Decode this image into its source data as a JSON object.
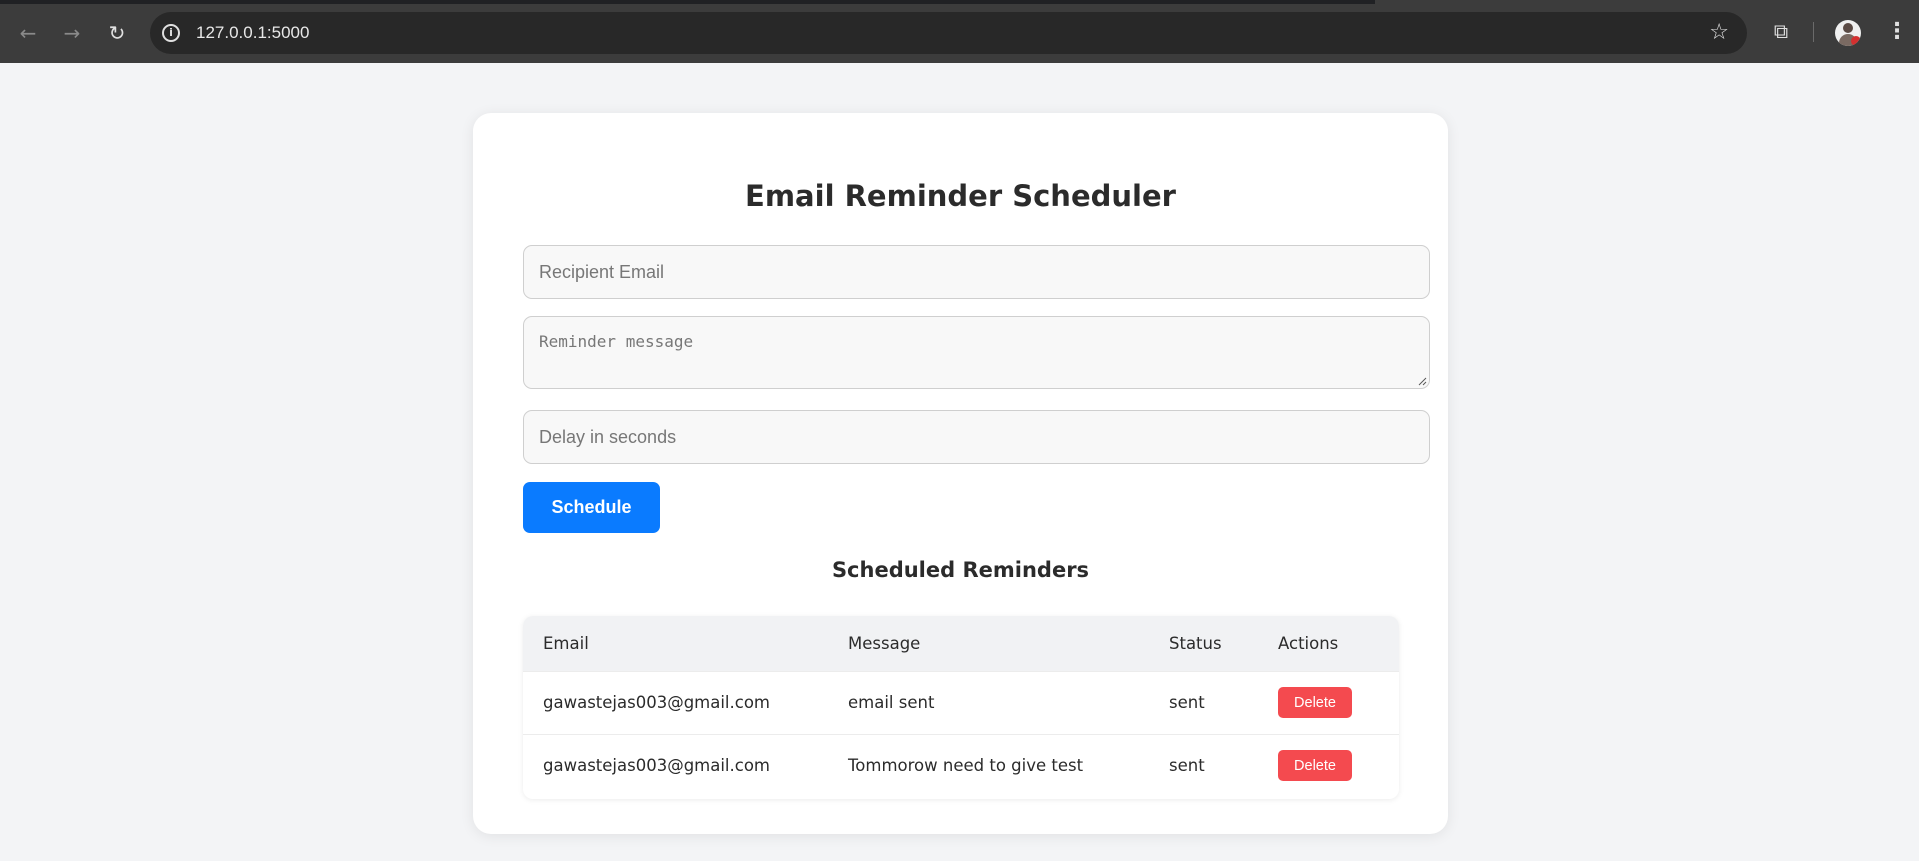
{
  "browser": {
    "url": "127.0.0.1:5000",
    "icons": {
      "back": "arrow-left-icon",
      "forward": "arrow-right-icon",
      "reload": "reload-icon",
      "info": "info-icon",
      "bookmark": "star-icon",
      "extensions": "puzzle-icon",
      "profile": "avatar",
      "menu": "kebab-menu-icon"
    }
  },
  "app": {
    "title": "Email Reminder Scheduler",
    "form": {
      "email_placeholder": "Recipient Email",
      "message_placeholder": "Reminder message",
      "delay_placeholder": "Delay in seconds",
      "submit_label": "Schedule"
    },
    "list_title": "Scheduled Reminders",
    "table": {
      "columns": [
        "Email",
        "Message",
        "Status",
        "Actions"
      ],
      "rows": [
        {
          "email": "gawastejas003@gmail.com",
          "message": "email sent",
          "status": "sent",
          "action": "Delete"
        },
        {
          "email": "gawastejas003@gmail.com",
          "message": "Tommorow need to give test",
          "status": "sent",
          "action": "Delete"
        }
      ]
    },
    "colors": {
      "primary": "#0a7bff",
      "danger": "#f44a4f",
      "background": "#f3f4f6"
    }
  }
}
